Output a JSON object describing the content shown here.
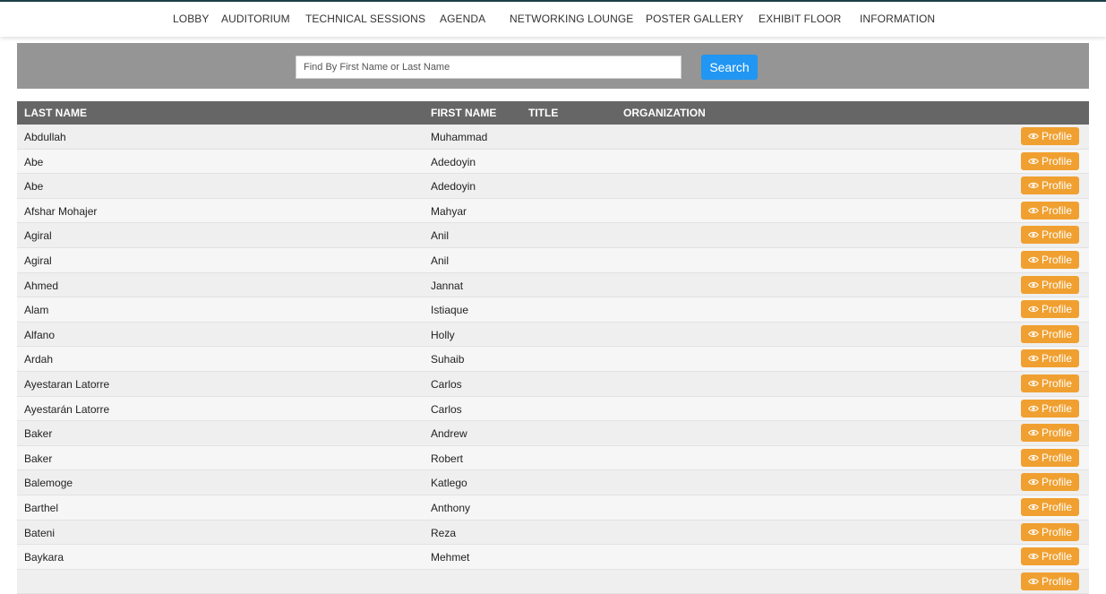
{
  "nav": {
    "items": [
      {
        "label": "LOBBY"
      },
      {
        "label": "AUDITORIUM"
      },
      {
        "label": "TECHNICAL SESSIONS"
      },
      {
        "label": "AGENDA"
      },
      {
        "label": "NETWORKING LOUNGE"
      },
      {
        "label": "POSTER GALLERY"
      },
      {
        "label": "EXHIBIT FLOOR"
      },
      {
        "label": "INFORMATION"
      }
    ]
  },
  "search": {
    "placeholder": "Find By First Name or Last Name",
    "value": "",
    "button_label": "Search"
  },
  "table": {
    "columns": [
      "LAST NAME",
      "FIRST NAME",
      "TITLE",
      "ORGANIZATION"
    ],
    "profile_label": "Profile",
    "rows": [
      {
        "last": "Abdullah",
        "first": "Muhammad"
      },
      {
        "last": "Abe",
        "first": "Adedoyin"
      },
      {
        "last": "Abe",
        "first": "Adedoyin"
      },
      {
        "last": "Afshar Mohajer",
        "first": "Mahyar"
      },
      {
        "last": "Agiral",
        "first": "Anil"
      },
      {
        "last": "Agiral",
        "first": "Anil"
      },
      {
        "last": "Ahmed",
        "first": "Jannat"
      },
      {
        "last": "Alam",
        "first": "Istiaque"
      },
      {
        "last": "Alfano",
        "first": "Holly"
      },
      {
        "last": "Ardah",
        "first": "Suhaib"
      },
      {
        "last": "Ayestaran Latorre",
        "first": "Carlos"
      },
      {
        "last": "Ayestarán Latorre",
        "first": "Carlos"
      },
      {
        "last": "Baker",
        "first": "Andrew"
      },
      {
        "last": "Baker",
        "first": "Robert"
      },
      {
        "last": "Balemoge",
        "first": "Katlego"
      },
      {
        "last": "Barthel",
        "first": "Anthony"
      },
      {
        "last": "Bateni",
        "first": "Reza"
      },
      {
        "last": "Baykara",
        "first": "Mehmet"
      },
      {
        "last": "",
        "first": ""
      }
    ]
  },
  "colors": {
    "accent": "#2196f3",
    "profile_button": "#f0a030",
    "header_bg": "#666666",
    "search_band": "#959595"
  }
}
